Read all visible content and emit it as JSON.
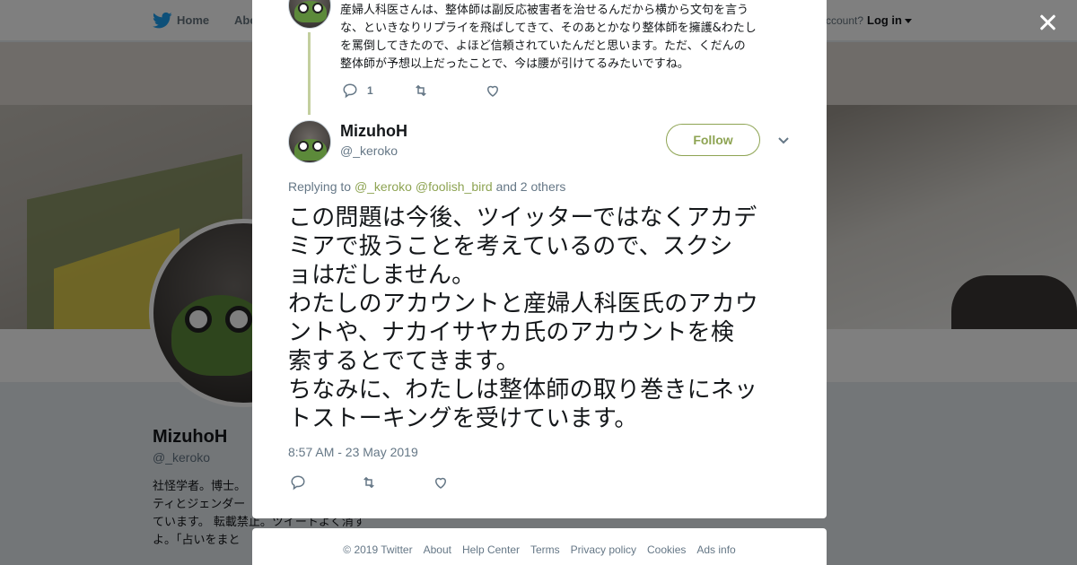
{
  "topnav": {
    "home": "Home",
    "about": "Abo",
    "account_prompt": "ccount?",
    "login": "Log in"
  },
  "profile": {
    "name": "MizuhoH",
    "handle": "@_keroko",
    "bio_lines": [
      "社怪学者。博士。",
      "ティとジェンダー",
      "ています。 転載禁止。ツイートよく消す",
      "よ。「占いをまと"
    ]
  },
  "parent_tweet": {
    "text_lines": [
      "産婦人科医さんは、整体師は副反応被害者を治せるんだから横から文句を言う",
      "な、といきなりリプライを飛ばしてきて、そのあとかなり整体師を擁護&わたし",
      "を罵倒してきたので、よほど信頼されていたんだと思います。ただ、くだんの",
      "整体師が予想以上だったことで、今は腰が引けてるみたいですね。"
    ],
    "reply_count": "1"
  },
  "tweet": {
    "author_name": "MizuhoH",
    "author_handle": "@_keroko",
    "follow_label": "Follow",
    "replying_prefix": "Replying to",
    "mention1": "@_keroko",
    "mention2": "@foolish_bird",
    "replying_suffix": "and 2 others",
    "text_lines": [
      "この問題は今後、ツイッターではなくアカデ",
      "ミアで扱うことを考えているので、スクシ",
      "ョはだしません。",
      "わたしのアカウントと産婦人科医氏のアカウ",
      "ントや、ナカイサヤカ氏のアカウントを検",
      "索するとでてきます。",
      "ちなみに、わたしは整体師の取り巻きにネッ",
      "トストーキングを受けています。"
    ],
    "timestamp": "8:57 AM - 23 May 2019"
  },
  "footer": {
    "copyright": "© 2019 Twitter",
    "links": [
      "About",
      "Help Center",
      "Terms",
      "Privacy policy",
      "Cookies",
      "Ads info"
    ]
  },
  "colors": {
    "accent": "#8ea453",
    "twitter_blue": "#1da1f2",
    "muted_text": "#657786"
  },
  "icons": {
    "close": "close-icon",
    "reply": "reply-icon",
    "retweet": "retweet-icon",
    "like": "heart-icon",
    "chevron": "chevron-down-icon",
    "bird": "twitter-bird-icon"
  }
}
